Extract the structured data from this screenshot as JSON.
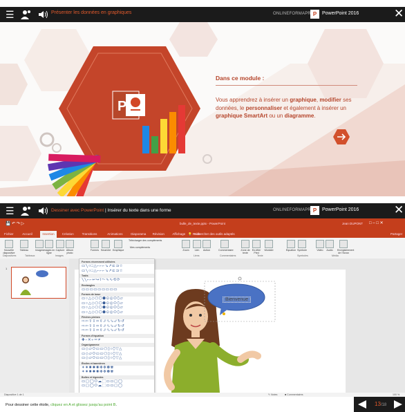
{
  "header": {
    "lesson_title": "Présenter les données en graphiques",
    "brand": "ONLINEFORMAPRO",
    "app_name": "PowerPoint 2016",
    "app_icon_letter": "P"
  },
  "intro": {
    "module_title": "Dans ce module :",
    "body_parts": [
      {
        "text": "Vous apprendrez à insérer un ",
        "bold": false
      },
      {
        "text": "graphique",
        "bold": true
      },
      {
        "text": ", ",
        "bold": false
      },
      {
        "text": "modifier",
        "bold": true
      },
      {
        "text": " ses données, le ",
        "bold": false
      },
      {
        "text": "personnaliser",
        "bold": true
      },
      {
        "text": " et également à insérer un ",
        "bold": false
      },
      {
        "text": "graphique SmartArt",
        "bold": true
      },
      {
        "text": " ou un ",
        "bold": false
      },
      {
        "text": "diagramme",
        "bold": true
      },
      {
        "text": ".",
        "bold": false
      }
    ],
    "logo_letter": "P"
  },
  "exercise_bar": {
    "prefix": "Dessiner avec PowerPoint",
    "suffix": " | Insérer du texte dans une forme"
  },
  "powerpoint": {
    "file_title": "bulle_de_texte.pptx - PowerPoint",
    "user": "Jean DUPONT",
    "tabs": [
      "Fichier",
      "Accueil",
      "Insertion",
      "Création",
      "Transitions",
      "Animations",
      "Diaporama",
      "Révision",
      "Affichage",
      "Aide"
    ],
    "active_tab": "Insertion",
    "tell_me": "Rechercher des outils adaptés",
    "share": "Partager",
    "ribbon_buttons": [
      "Nouvelle diapositive",
      "Tableau",
      "Images",
      "Images en ligne",
      "Capture",
      "Album photo",
      "Formes",
      "SmartArt",
      "Graphique",
      "Télécharger des compléments",
      "Mes compléments",
      "Zoom",
      "Lien",
      "Action",
      "Commentaire",
      "Zone de texte",
      "En-tête/ Pied",
      "WordArt",
      "Équation",
      "Symbole",
      "Vidéo",
      "Audio",
      "Enregistrement de l'écran"
    ],
    "ribbon_groups": [
      "Diapositives",
      "Tableaux",
      "Images",
      "Liens",
      "Commentaires",
      "Texte",
      "Symboles",
      "Média"
    ],
    "shape_categories": [
      "Formes récemment utilisées",
      "Traits",
      "Rectangles",
      "Formes de base",
      "Flèches pleines",
      "Formes d'équation",
      "Organigramme",
      "Étoiles et bannières",
      "Bulles et légendes"
    ],
    "slide_number": "1",
    "bubble_text": "Bienvenue",
    "status_left": "Diapositive 1 de 1",
    "status_notes": "Notes",
    "status_comments": "Commentaires",
    "zoom": "100 %"
  },
  "footer": {
    "instr_before": "Pour dessiner cette étoile, ",
    "instr_green": "cliquez en A et glissez jusqu'au point B",
    "instr_after": ".",
    "page_current": "13",
    "page_total": "/18"
  },
  "colors": {
    "accent": "#c43e1c",
    "orange": "#e25a2c",
    "bubble": "#4a72c4",
    "dark": "#1b1b1b"
  }
}
